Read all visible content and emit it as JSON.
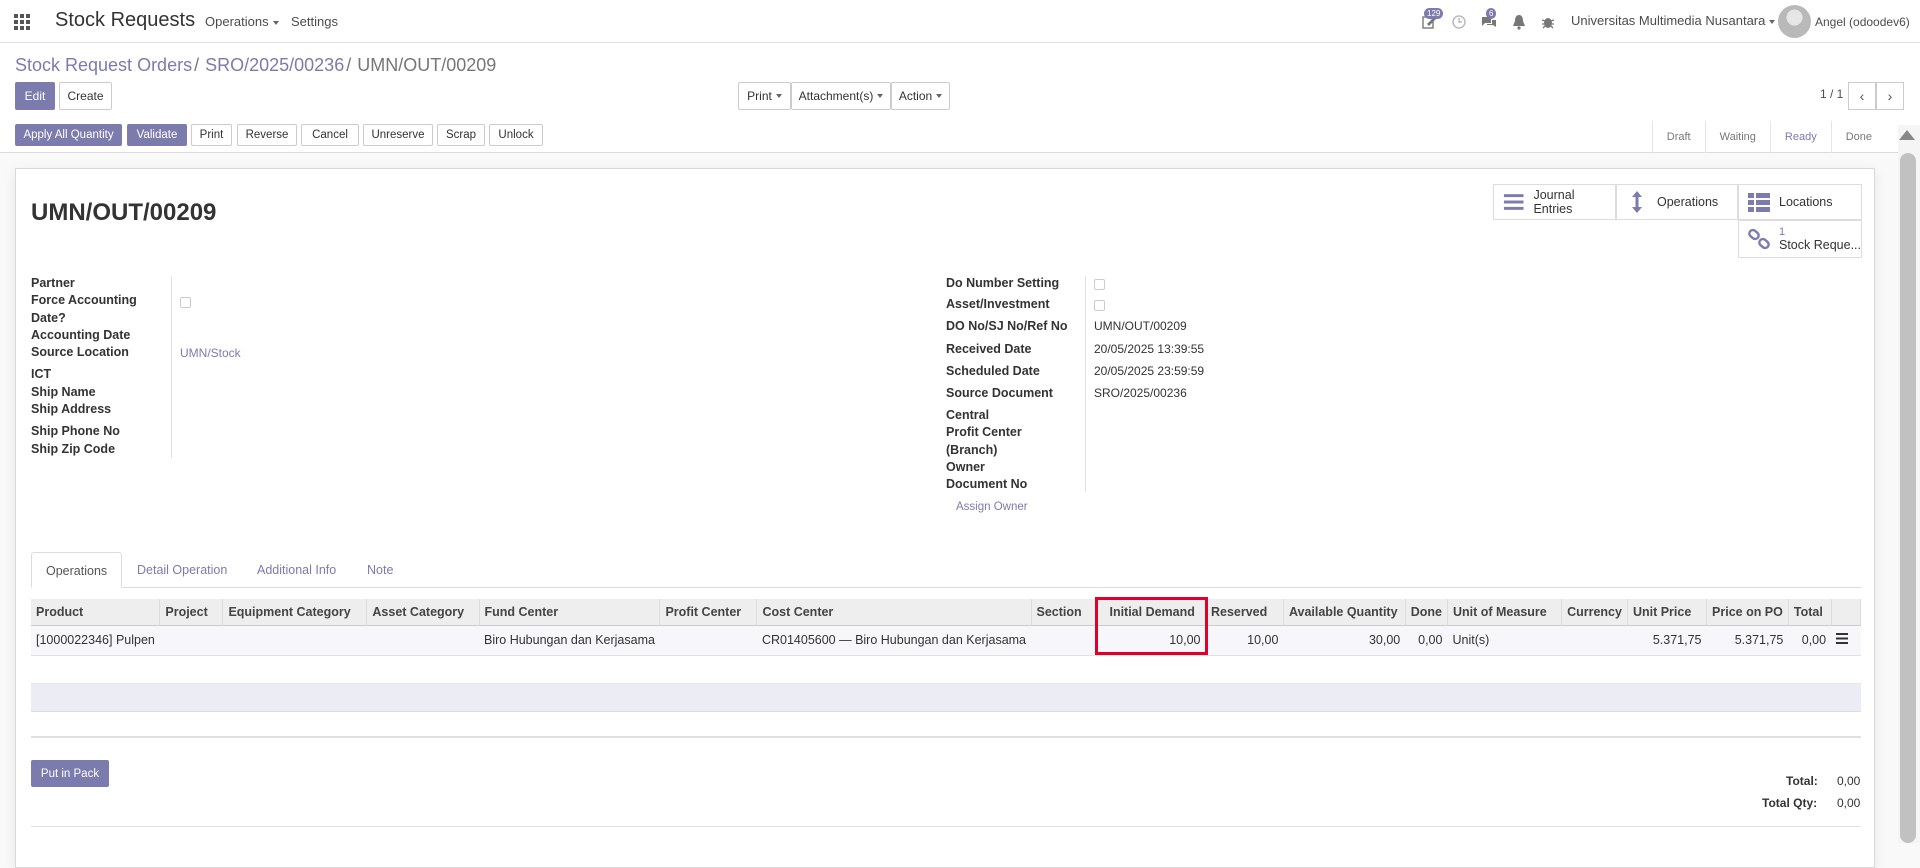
{
  "navbar": {
    "app_title": "Stock Requests",
    "menu_operations": "Operations",
    "menu_settings": "Settings",
    "badge_activities": "129",
    "badge_messages": "6",
    "company": "Universitas Multimedia Nusantara",
    "user": "Angel (odoodev6)"
  },
  "breadcrumb": {
    "item1": "Stock Request Orders",
    "item2": "SRO/2025/00236",
    "current": "UMN/OUT/00209",
    "sep": "/"
  },
  "toolbar": {
    "edit": "Edit",
    "create": "Create",
    "print": "Print",
    "attachments": "Attachment(s)",
    "action": "Action",
    "pager": "1 / 1"
  },
  "actions": {
    "apply_all": "Apply All Quantity",
    "validate": "Validate",
    "print": "Print",
    "reverse": "Reverse",
    "cancel": "Cancel",
    "unreserve": "Unreserve",
    "scrap": "Scrap",
    "unlock": "Unlock"
  },
  "statusbar": [
    "Draft",
    "Waiting",
    "Ready",
    "Done"
  ],
  "statusbar_current": "Ready",
  "record": {
    "title": "UMN/OUT/00209"
  },
  "smart_buttons": {
    "journal": "Journal Entries",
    "operations": "Operations",
    "locations": "Locations",
    "stock_req_count": "1",
    "stock_req_label": "Stock Reque..."
  },
  "left_fields": {
    "partner": "Partner",
    "force_acc": "Force Accounting",
    "force_acc2": "Date?",
    "acc_date": "Accounting Date",
    "source_loc": "Source Location",
    "source_loc_val": "UMN/Stock",
    "ict": "ICT",
    "ship_name": "Ship Name",
    "ship_address": "Ship Address",
    "ship_phone": "Ship Phone No",
    "ship_zip": "Ship Zip Code"
  },
  "right_fields": {
    "do_number": "Do Number Setting",
    "asset_inv": "Asset/Investment",
    "do_no": "DO No/SJ No/Ref No",
    "do_no_val": "UMN/OUT/00209",
    "received": "Received Date",
    "received_val": "20/05/2025 13:39:55",
    "scheduled": "Scheduled Date",
    "scheduled_val": "20/05/2025 23:59:59",
    "source_doc": "Source Document",
    "source_doc_val": "SRO/2025/00236",
    "central": "Central",
    "profit_center": "Profit Center",
    "branch": "(Branch)",
    "owner": "Owner",
    "document_no": "Document No",
    "assign_owner": "Assign Owner"
  },
  "tabs": [
    "Operations",
    "Detail Operation",
    "Additional Info",
    "Note"
  ],
  "table": {
    "headers": [
      "Product",
      "Project",
      "Equipment Category",
      "Asset Category",
      "Fund Center",
      "Profit Center",
      "Cost Center",
      "Section",
      "Initial Demand",
      "Reserved",
      "Available Quantity",
      "Done",
      "Unit of Measure",
      "Currency",
      "Unit Price",
      "Price on PO",
      "Total"
    ],
    "row": [
      "[1000022346] Pulpen",
      "",
      "",
      "",
      "Biro Hubungan dan Kerjasama",
      "",
      "CR01405600 — Biro Hubungan dan Kerjasama",
      "",
      "10,00",
      "10,00",
      "30,00",
      "0,00",
      "Unit(s)",
      "",
      "5.371,75",
      "5.371,75",
      "0,00"
    ]
  },
  "footer": {
    "put_in_pack": "Put in Pack",
    "total_label": "Total:",
    "total_val": "0,00",
    "total_qty_label": "Total Qty:",
    "total_qty_val": "0,00"
  },
  "colors": {
    "primary": "#7c7bad",
    "highlight": "#e0002a"
  }
}
